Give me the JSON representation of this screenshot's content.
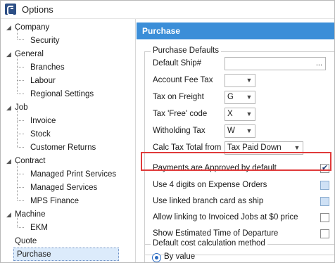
{
  "window": {
    "title": "Options"
  },
  "tree": {
    "items": [
      {
        "label": "Company",
        "level": 0
      },
      {
        "label": "Security",
        "level": 1
      },
      {
        "label": "General",
        "level": 0
      },
      {
        "label": "Branches",
        "level": 1
      },
      {
        "label": "Labour",
        "level": 1
      },
      {
        "label": "Regional Settings",
        "level": 1
      },
      {
        "label": "Job",
        "level": 0
      },
      {
        "label": "Invoice",
        "level": 1
      },
      {
        "label": "Stock",
        "level": 1
      },
      {
        "label": "Customer Returns",
        "level": 1
      },
      {
        "label": "Contract",
        "level": 0
      },
      {
        "label": "Managed Print Services",
        "level": 1
      },
      {
        "label": "Managed Services",
        "level": 1
      },
      {
        "label": "MPS Finance",
        "level": 1
      },
      {
        "label": "Machine",
        "level": 0
      },
      {
        "label": "EKM",
        "level": 1
      },
      {
        "label": "Quote",
        "level": 0
      },
      {
        "label": "Purchase",
        "level": 0,
        "selected": true
      }
    ]
  },
  "panel": {
    "header": "Purchase",
    "defaults_group": {
      "title": "Purchase Defaults",
      "fields": [
        {
          "label": "Default Ship#",
          "value": "",
          "button": "..."
        },
        {
          "label": "Account Fee Tax",
          "value": ""
        },
        {
          "label": "Tax on Freight",
          "value": "G"
        },
        {
          "label": "Tax 'Free' code",
          "value": "X"
        },
        {
          "label": "Witholding Tax",
          "value": "W"
        },
        {
          "label": "Calc Tax Total from",
          "value": "Tax Paid Down"
        }
      ],
      "checkboxes": [
        {
          "label": "Payments are Approved by default",
          "checked": true,
          "highlighted": true
        },
        {
          "label": "Use 4 digits on Expense Orders",
          "checked": false
        },
        {
          "label": "Use linked branch card as ship",
          "checked": false
        },
        {
          "label": "Allow linking to Invoiced Jobs at $0 price",
          "checked": false
        },
        {
          "label": "Show Estimated Time of Departure",
          "checked": false
        }
      ]
    },
    "cost_group": {
      "title": "Default cost calculation method",
      "option": "By value"
    }
  },
  "colors": {
    "header_blue": "#3b8ed8",
    "highlight_red": "#e03a3a",
    "selection": "#dcebfb"
  }
}
